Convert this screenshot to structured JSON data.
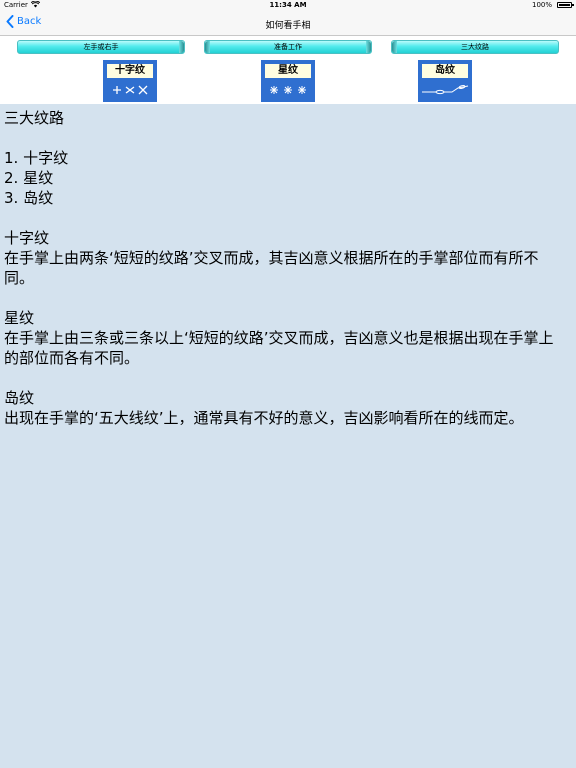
{
  "status_bar": {
    "carrier": "Carrier",
    "time": "11:34 AM",
    "battery": "100%"
  },
  "nav": {
    "back_label": "Back",
    "title": "如何看手相"
  },
  "tabs": [
    {
      "label": "左手或右手"
    },
    {
      "label": "准备工作"
    },
    {
      "label": "三大纹路"
    }
  ],
  "thumbnails": [
    {
      "label": "十字纹",
      "marks": "+ × ×"
    },
    {
      "label": "星纹",
      "marks": "✳ ✳ ✳"
    },
    {
      "label": "岛纹",
      "marks": ""
    }
  ],
  "content": {
    "heading": "三大纹路",
    "list": [
      "1. 十字纹",
      "2. 星纹",
      "3. 岛纹"
    ],
    "sections": [
      {
        "title": "十字纹",
        "body": "在手掌上由两条‘短短的纹路’交叉而成，其吉凶意义根据所在的手掌部位而有所不同。"
      },
      {
        "title": "星纹",
        "body": "在手掌上由三条或三条以上‘短短的纹路’交叉而成，吉凶意义也是根据出现在手掌上的部位而各有不同。"
      },
      {
        "title": "岛纹",
        "body": "出现在手掌的‘五大线纹’上，通常具有不好的意义，吉凶影响看所在的线而定。"
      }
    ]
  },
  "colors": {
    "background": "#d4e2ee",
    "accent": "#0a7aff",
    "tab": "#52eaec",
    "thumbnail": "#2f6fd0"
  }
}
